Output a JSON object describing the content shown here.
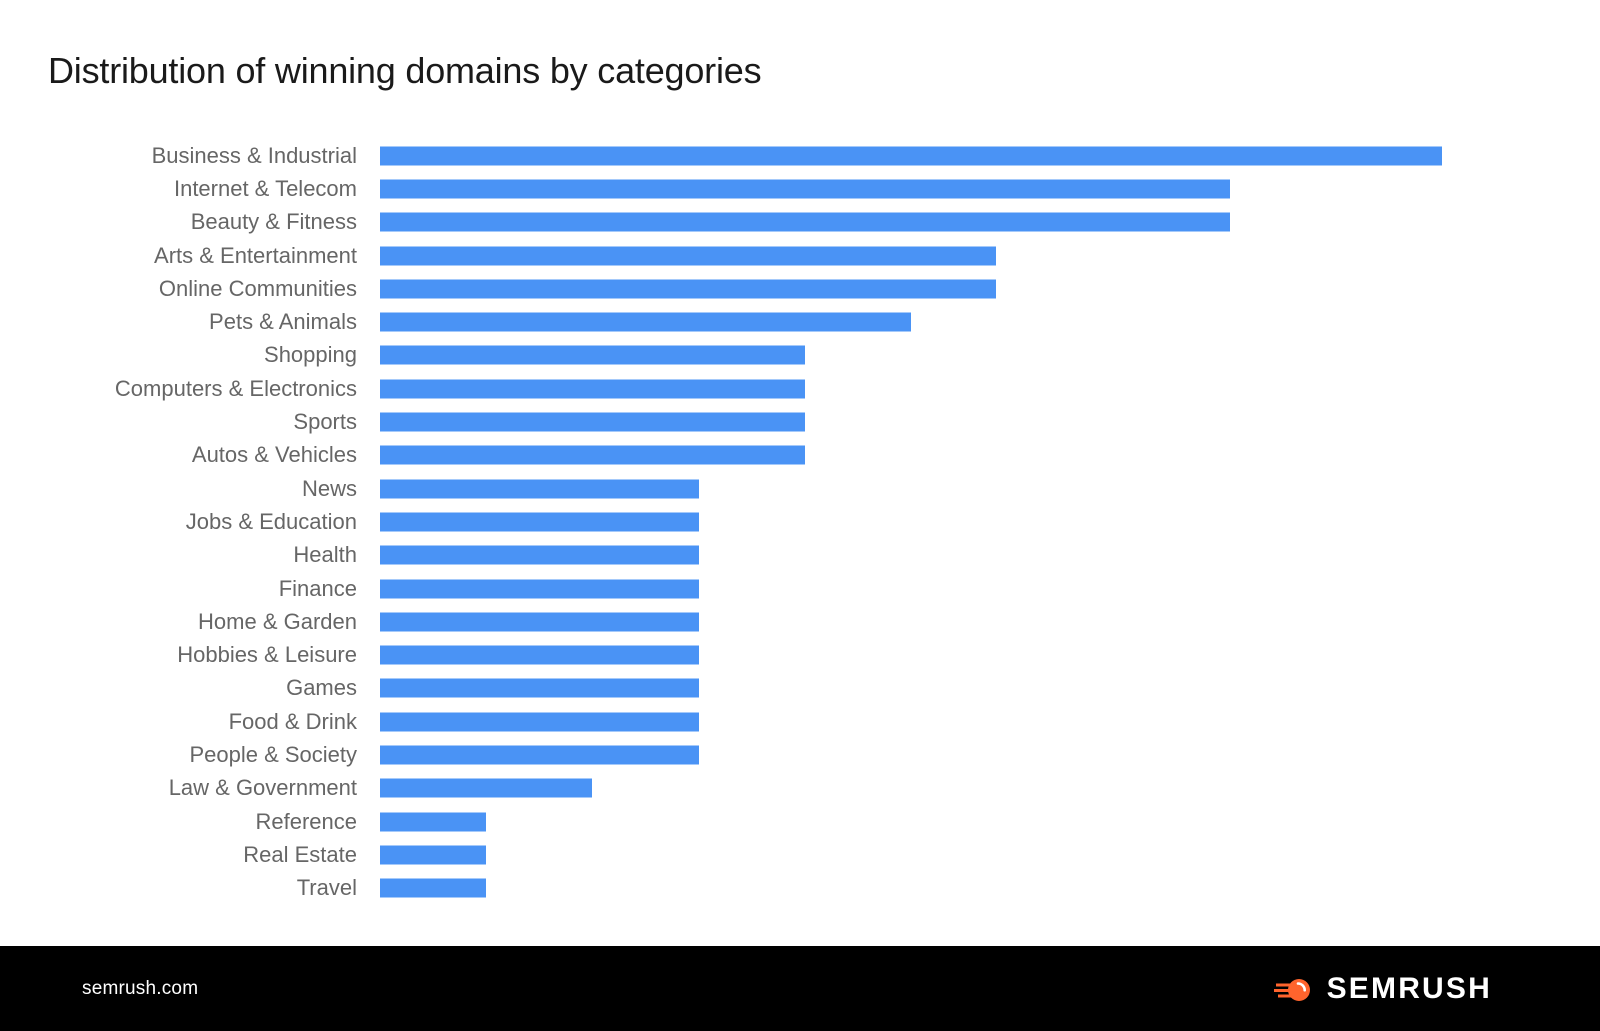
{
  "chart_data": {
    "type": "bar",
    "orientation": "horizontal",
    "title": "Distribution of winning domains by categories",
    "xlabel": "",
    "ylabel": "",
    "grid": false,
    "legend": null,
    "bar_color": "#4a93f5",
    "xlim": [
      0,
      100
    ],
    "categories": [
      "Business & Industrial",
      "Internet & Telecom",
      "Beauty & Fitness",
      "Arts & Entertainment",
      "Online Communities",
      "Pets & Animals",
      "Shopping",
      "Computers & Electronics",
      "Sports",
      "Autos & Vehicles",
      "News",
      "Jobs & Education",
      "Health",
      "Finance",
      "Home & Garden",
      "Hobbies & Leisure",
      "Games",
      "Food & Drink",
      "People & Society",
      "Law & Government",
      "Reference",
      "Real Estate",
      "Travel"
    ],
    "values": [
      100,
      80,
      80,
      58,
      58,
      50,
      40,
      40,
      40,
      40,
      30,
      30,
      30,
      30,
      30,
      30,
      30,
      30,
      30,
      20,
      10,
      10,
      10
    ]
  },
  "header": {
    "title": "Distribution of winning domains by categories"
  },
  "footer": {
    "url": "semrush.com",
    "brand": "SEMRUSH",
    "logo_icon": "semrush-comet-icon",
    "background": "#000000",
    "accent": "#ff642d"
  }
}
